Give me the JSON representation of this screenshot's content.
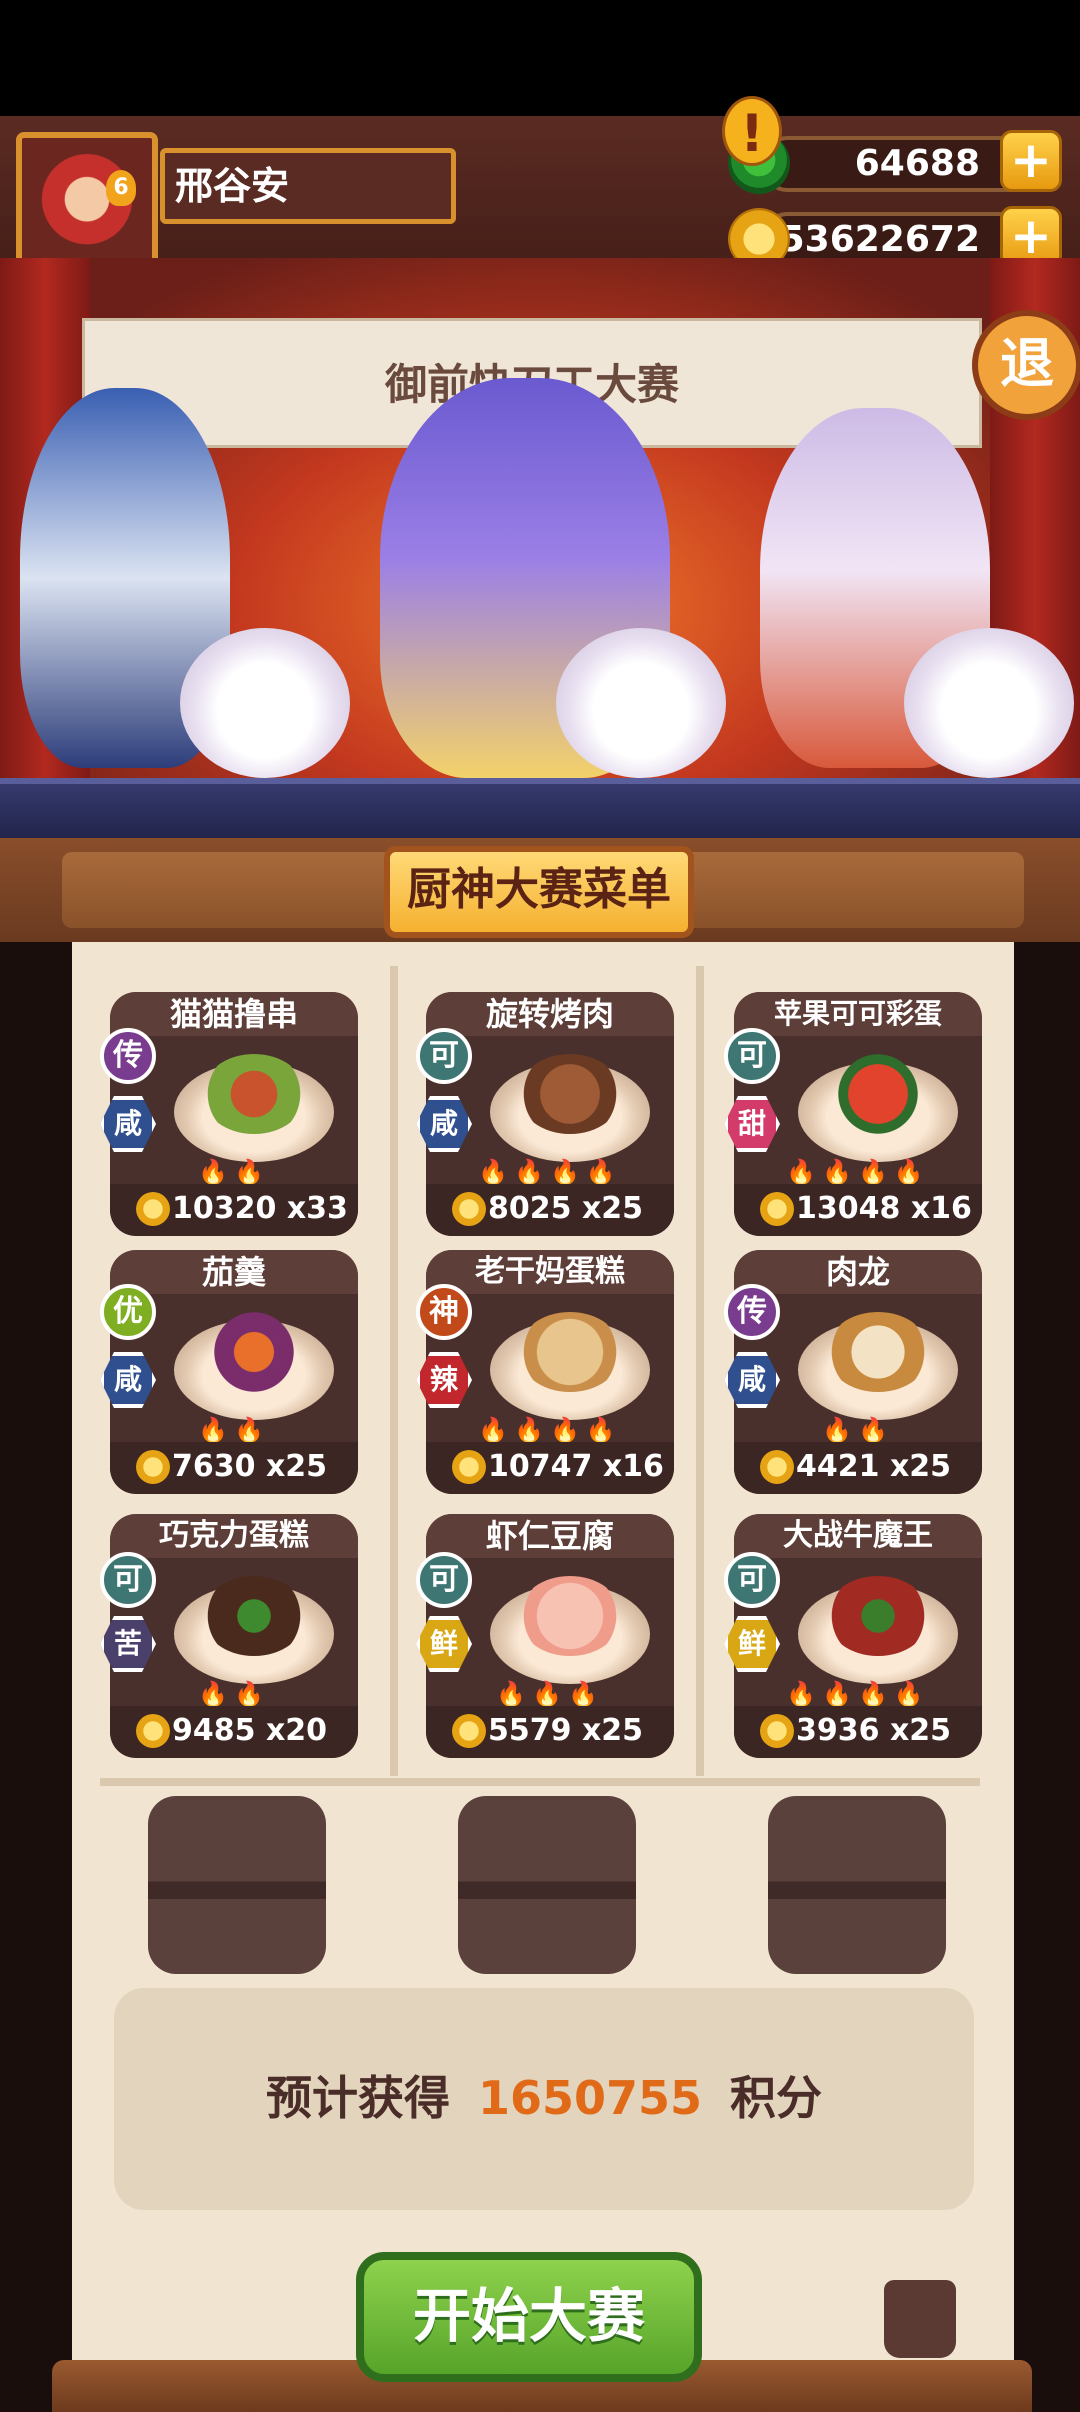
{
  "header": {
    "player_name": "邢谷安",
    "avatar_badge": "6",
    "jade_amount": "64688",
    "coin_amount": "53622672",
    "plus_label": "+"
  },
  "scene": {
    "banner_title": "御前快刀工大赛",
    "exclaim": "!",
    "exit_label": "退"
  },
  "menu": {
    "title": "厨神大赛菜单",
    "dishes": [
      {
        "name": "猫猫撸串",
        "rank": "传",
        "flavor": "咸",
        "points": "10320",
        "count": "x33"
      },
      {
        "name": "旋转烤肉",
        "rank": "可",
        "flavor": "咸",
        "points": "8025",
        "count": "x25"
      },
      {
        "name": "苹果可可彩蛋",
        "rank": "可",
        "flavor": "甜",
        "points": "13048",
        "count": "x16"
      },
      {
        "name": "茄羹",
        "rank": "优",
        "flavor": "咸",
        "points": "7630",
        "count": "x25"
      },
      {
        "name": "老干妈蛋糕",
        "rank": "神",
        "flavor": "辣",
        "points": "10747",
        "count": "x16"
      },
      {
        "name": "肉龙",
        "rank": "传",
        "flavor": "咸",
        "points": "4421",
        "count": "x25"
      },
      {
        "name": "巧克力蛋糕",
        "rank": "可",
        "flavor": "苦",
        "points": "9485",
        "count": "x20"
      },
      {
        "name": "虾仁豆腐",
        "rank": "可",
        "flavor": "鲜",
        "points": "5579",
        "count": "x25"
      },
      {
        "name": "大战牛魔王",
        "rank": "可",
        "flavor": "鲜",
        "points": "3936",
        "count": "x25"
      }
    ]
  },
  "estimate": {
    "prefix": "预计获得",
    "value": "1650755",
    "suffix": "积分"
  },
  "start_button": "开始大赛",
  "colors": {
    "rank_legend": "#7a3c8e",
    "rank_ke": "#3d7672",
    "rank_you": "#7fae23",
    "rank_shen": "#c24a1a",
    "flavor_salty": "#2f4f8f",
    "flavor_sweet": "#d23b6a",
    "flavor_spicy": "#c1272d",
    "flavor_bitter": "#4b3f6b",
    "flavor_fresh": "#d9a714",
    "estimate_value": "#e06a17"
  }
}
